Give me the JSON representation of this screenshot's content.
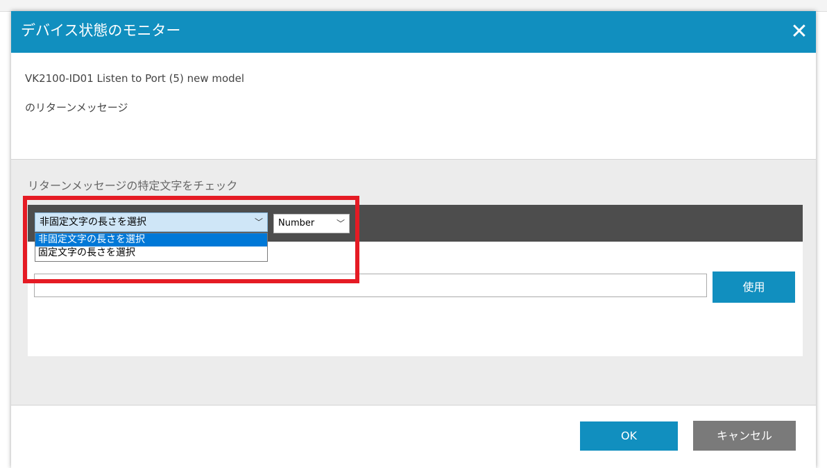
{
  "dialog": {
    "title": "デバイス状態のモニター",
    "close_glyph": "✕",
    "device_name": "VK2100-ID01 Listen to Port (5) new model",
    "return_message_label": "のリターンメッセージ"
  },
  "check_section": {
    "label": "リターンメッセージの特定文字をチェック",
    "length_select": {
      "value": "非固定文字の長さを選択",
      "options": [
        "非固定文字の長さを選択",
        "固定文字の長さを選択"
      ],
      "highlighted_index": 0
    },
    "format_select": {
      "value": "Number"
    },
    "text_input": {
      "value": ""
    },
    "use_button_label": "使用"
  },
  "footer": {
    "ok_label": "OK",
    "cancel_label": "キャンセル"
  },
  "colors": {
    "accent": "#118fbf",
    "highlight_frame": "#e51b24",
    "dark_bar": "#4d4d4d",
    "selected_option": "#0078d7",
    "cancel": "#7a7a7a"
  }
}
